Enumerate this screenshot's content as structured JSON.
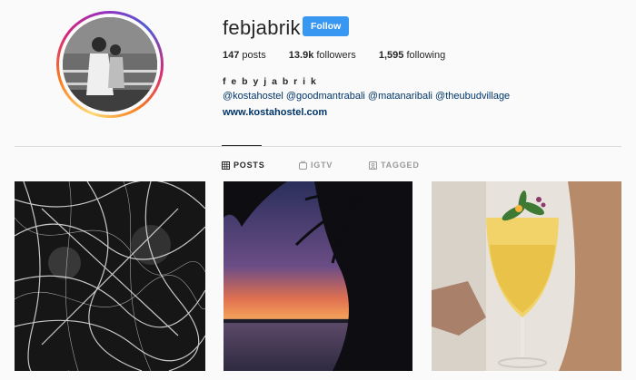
{
  "profile": {
    "username": "febjabrik",
    "follow_label": "Follow",
    "full_name": "f e b y j a b r i k",
    "mentions": "@kostahostel @goodmantrabali @matanaribali @theubudvillage",
    "website": "www.kostahostel.com"
  },
  "stats": {
    "posts_count": "147",
    "posts_label": "posts",
    "followers_count": "13.9k",
    "followers_label": "followers",
    "following_count": "1,595",
    "following_label": "following"
  },
  "tabs": [
    {
      "label": "POSTS",
      "icon": "grid-icon",
      "active": true
    },
    {
      "label": "IGTV",
      "icon": "igtv-icon",
      "active": false
    },
    {
      "label": "TAGGED",
      "icon": "tagged-icon",
      "active": false
    }
  ],
  "colors": {
    "follow_button": "#3897f0",
    "link": "#003569",
    "background": "#fafafa"
  }
}
